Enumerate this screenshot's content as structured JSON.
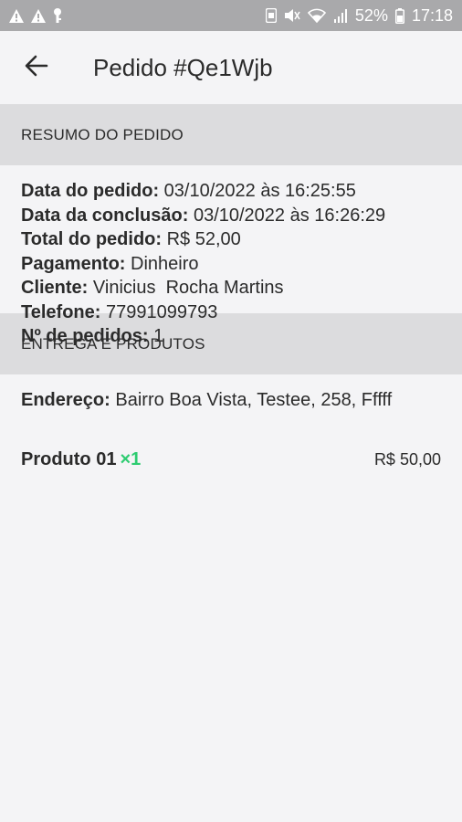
{
  "statusbar": {
    "battery": "52%",
    "time": "17:18"
  },
  "header": {
    "title": "Pedido #Qe1Wjb"
  },
  "summary": {
    "section_title": "RESUMO DO PEDIDO",
    "rows": [
      {
        "label": "Data do pedido:",
        "value": "03/10/2022 às 16:25:55"
      },
      {
        "label": "Data da conclusão:",
        "value": "03/10/2022 às 16:26:29"
      },
      {
        "label": "Total do pedido:",
        "value": "R$ 52,00"
      },
      {
        "label": "Pagamento:",
        "value": "Dinheiro"
      },
      {
        "label": "Cliente:",
        "value": "Vinicius  Rocha Martins"
      },
      {
        "label": "Telefone:",
        "value": "77991099793"
      },
      {
        "label": "Nº de pedidos:",
        "value": "1"
      }
    ]
  },
  "delivery": {
    "section_title": "ENTREGA E PRODUTOS",
    "address_label": "Endereço:",
    "address_value": "Bairro Boa Vista, Testee, 258, Fffff",
    "products": [
      {
        "name": "Produto 01",
        "qty": "×1",
        "price": "R$ 50,00"
      }
    ]
  },
  "colors": {
    "qty_accent": "#2ecc71",
    "section_bg": "#dcdcde",
    "statusbar_bg": "#a9a9ab"
  }
}
